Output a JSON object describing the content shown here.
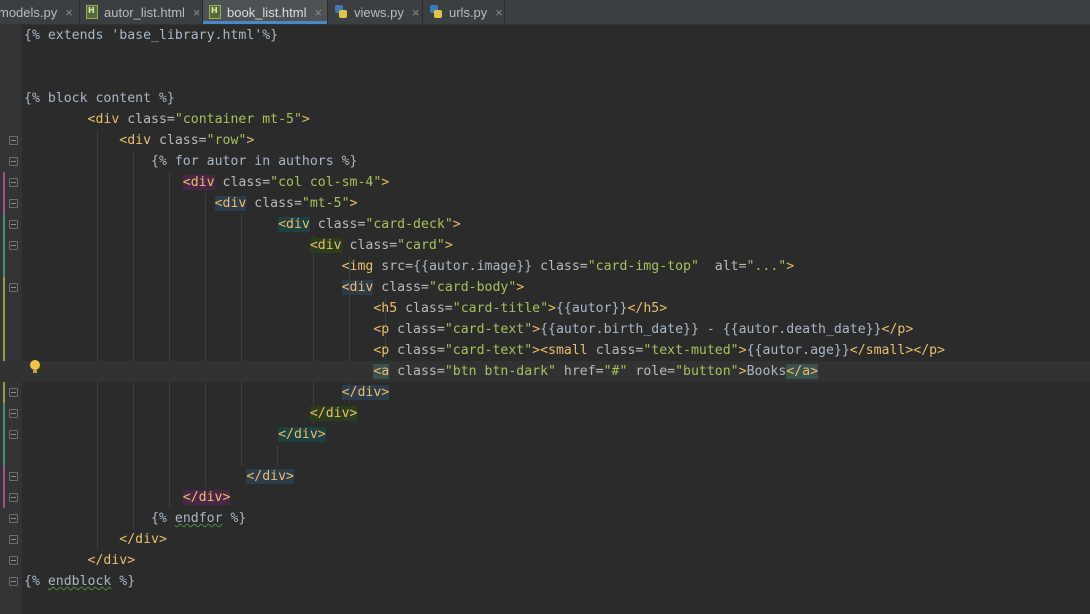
{
  "tabs": [
    {
      "label": "models.py",
      "icon": "python-file-icon",
      "active": false
    },
    {
      "label": "autor_list.html",
      "icon": "html-file-icon",
      "active": false
    },
    {
      "label": "book_list.html",
      "icon": "html-file-icon",
      "active": true
    },
    {
      "label": "views.py",
      "icon": "python-file-icon",
      "active": false
    },
    {
      "label": "urls.py",
      "icon": "python-file-icon",
      "active": false
    }
  ],
  "tab_close_glyph": "×",
  "editor": {
    "lines": [
      [
        [
          "{% extends ",
          "tmpl"
        ],
        [
          "'base_library.html'",
          "txt"
        ],
        [
          "%}",
          "tmpl"
        ]
      ],
      [],
      [],
      [
        [
          "{% block content %}",
          "tmpl"
        ]
      ],
      [
        [
          "        ",
          "txt"
        ],
        [
          "<div ",
          "tag"
        ],
        [
          "class=",
          "attr"
        ],
        [
          "\"container mt-5\"",
          "str"
        ],
        [
          ">",
          "tag"
        ]
      ],
      [
        [
          "            ",
          "txt"
        ],
        [
          "<div ",
          "tag"
        ],
        [
          "class=",
          "attr"
        ],
        [
          "\"row\"",
          "str"
        ],
        [
          ">",
          "tag"
        ]
      ],
      [
        [
          "                ",
          "txt"
        ],
        [
          "{% for autor in authors %}",
          "tmpl"
        ]
      ],
      [
        [
          "                    ",
          "txt"
        ],
        [
          "<div",
          "tag",
          "purple"
        ],
        [
          " class=",
          "attr"
        ],
        [
          "\"col col-sm-4\"",
          "str"
        ],
        [
          ">",
          "tag"
        ]
      ],
      [
        [
          "                        ",
          "txt"
        ],
        [
          "<div",
          "tag",
          "slate"
        ],
        [
          " class=",
          "attr"
        ],
        [
          "\"mt-5\"",
          "str"
        ],
        [
          ">",
          "tag"
        ]
      ],
      [
        [
          "                                ",
          "txt"
        ],
        [
          "<div",
          "tag",
          "teal"
        ],
        [
          " class=",
          "attr"
        ],
        [
          "\"card-deck\"",
          "str"
        ],
        [
          ">",
          "tag"
        ]
      ],
      [
        [
          "                                    ",
          "txt"
        ],
        [
          "<div",
          "tag",
          "green"
        ],
        [
          " class=",
          "attr"
        ],
        [
          "\"card\"",
          "str"
        ],
        [
          ">",
          "tag"
        ]
      ],
      [
        [
          "                                        ",
          "txt"
        ],
        [
          "<img ",
          "tag"
        ],
        [
          "src=",
          "attr"
        ],
        [
          "{{autor.image}}",
          "tmpl"
        ],
        [
          " class=",
          "attr"
        ],
        [
          "\"card-img-top\"",
          "str"
        ],
        [
          "  alt=",
          "attr"
        ],
        [
          "\"...\"",
          "str"
        ],
        [
          ">",
          "tag"
        ]
      ],
      [
        [
          "                                        ",
          "txt"
        ],
        [
          "<div",
          "tag",
          "slate"
        ],
        [
          " class=",
          "attr"
        ],
        [
          "\"card-body\"",
          "str"
        ],
        [
          ">",
          "tag"
        ]
      ],
      [
        [
          "                                            ",
          "txt"
        ],
        [
          "<h5 ",
          "tag"
        ],
        [
          "class=",
          "attr"
        ],
        [
          "\"card-title\"",
          "str"
        ],
        [
          ">",
          "tag"
        ],
        [
          "{{autor}}",
          "tmpl"
        ],
        [
          "</h5>",
          "tag"
        ]
      ],
      [
        [
          "                                            ",
          "txt"
        ],
        [
          "<p ",
          "tag"
        ],
        [
          "class=",
          "attr"
        ],
        [
          "\"card-text\"",
          "str"
        ],
        [
          ">",
          "tag"
        ],
        [
          "{{autor.birth_date}}",
          "tmpl"
        ],
        [
          " - ",
          "txt"
        ],
        [
          "{{autor.death_date}}",
          "tmpl"
        ],
        [
          "</p>",
          "tag"
        ]
      ],
      [
        [
          "                                            ",
          "txt"
        ],
        [
          "<p ",
          "tag"
        ],
        [
          "class=",
          "attr"
        ],
        [
          "\"card-text\"",
          "str"
        ],
        [
          "><small ",
          "tag"
        ],
        [
          "class=",
          "attr"
        ],
        [
          "\"text-muted\"",
          "str"
        ],
        [
          ">",
          "tag"
        ],
        [
          "{{autor.age}}",
          "tmpl"
        ],
        [
          "</small></p>",
          "tag"
        ]
      ],
      [
        [
          "                                            ",
          "txt"
        ],
        [
          "<a",
          "tag",
          "match"
        ],
        [
          " class=",
          "attr"
        ],
        [
          "\"btn btn-dark\"",
          "str"
        ],
        [
          " href=",
          "attr"
        ],
        [
          "\"#\"",
          "str"
        ],
        [
          " role=",
          "attr"
        ],
        [
          "\"button\"",
          "str"
        ],
        [
          ">",
          "tag"
        ],
        [
          "Books",
          "txt"
        ],
        [
          "</a",
          "tag",
          "match"
        ],
        [
          ">",
          "tag",
          "match"
        ]
      ],
      [
        [
          "                                        ",
          "txt"
        ],
        [
          "</div>",
          "tag",
          "slate"
        ]
      ],
      [
        [
          "                                    ",
          "txt"
        ],
        [
          "</div>",
          "tag",
          "green"
        ]
      ],
      [
        [
          "                                ",
          "txt"
        ],
        [
          "</div>",
          "tag",
          "teal"
        ]
      ],
      [],
      [
        [
          "                            ",
          "txt"
        ],
        [
          "</div>",
          "tag",
          "slate"
        ]
      ],
      [
        [
          "                    ",
          "txt"
        ],
        [
          "</div>",
          "tag",
          "purple"
        ]
      ],
      [
        [
          "                ",
          "txt"
        ],
        [
          "{% ",
          "tmpl"
        ],
        [
          "endfor",
          "tmpl",
          "squig"
        ],
        [
          " %}",
          "tmpl"
        ]
      ],
      [
        [
          "            ",
          "txt"
        ],
        [
          "</div>",
          "tag"
        ]
      ],
      [
        [
          "        ",
          "txt"
        ],
        [
          "</div>",
          "tag"
        ]
      ],
      [
        [
          "{% ",
          "tmpl"
        ],
        [
          "endblock",
          "tmpl",
          "squig"
        ],
        [
          " %}",
          "tmpl"
        ]
      ]
    ]
  },
  "colors": {
    "background": "#2b2b2b",
    "gutter": "#313335",
    "tab_bar": "#3c3f41",
    "active_tab_underline": "#4a88c7",
    "template_tag": "#a9b7c6",
    "html_tag": "#e8bf6a",
    "attribute": "#bababa",
    "string": "#a5c25c"
  }
}
